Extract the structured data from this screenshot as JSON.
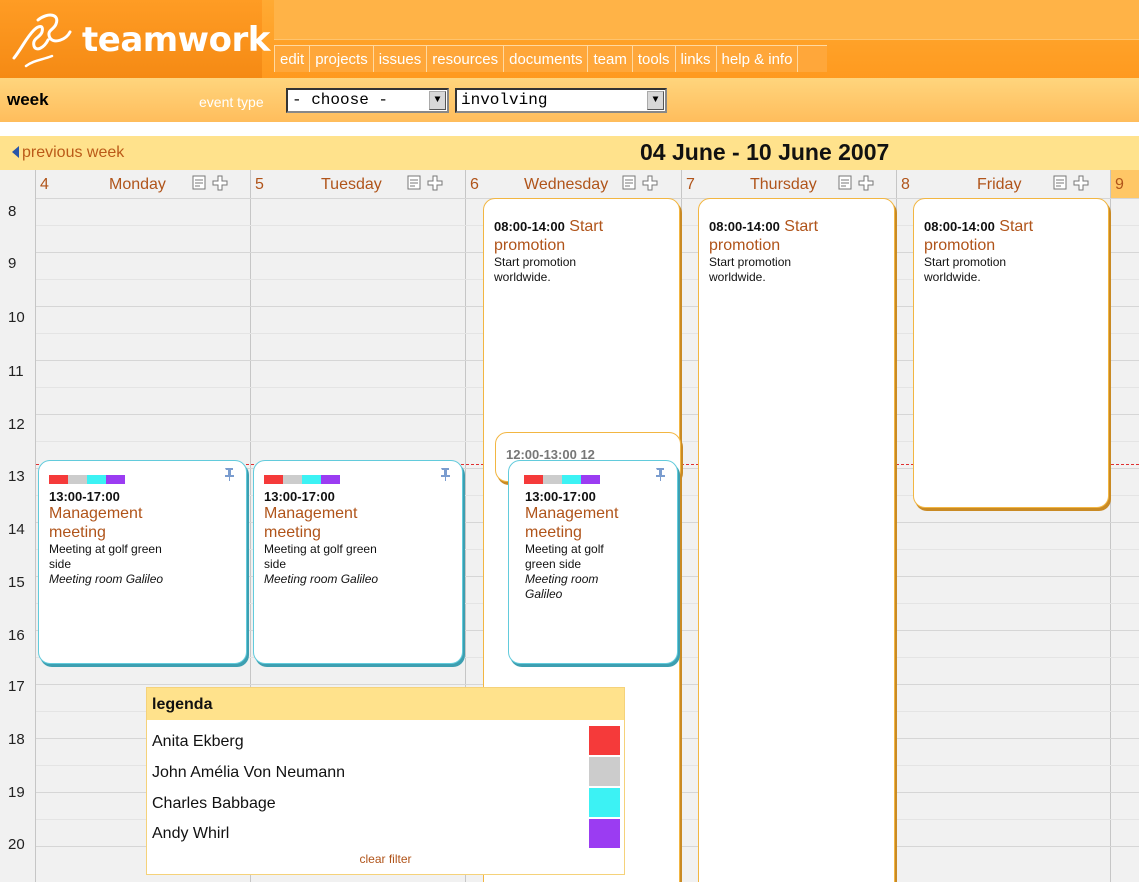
{
  "app": {
    "logo_text": "teamwork"
  },
  "nav": {
    "items": [
      "edit",
      "projects",
      "issues",
      "resources",
      "documents",
      "team",
      "tools",
      "links",
      "help & info"
    ]
  },
  "toolbar": {
    "page_label": "week",
    "event_type_label": "event type",
    "event_type_value": "- choose -",
    "involving_value": "involving"
  },
  "week": {
    "prev_label": "previous week",
    "title": "04 June - 10 June 2007"
  },
  "days": [
    {
      "num": "4",
      "name": "Monday"
    },
    {
      "num": "5",
      "name": "Tuesday"
    },
    {
      "num": "6",
      "name": "Wednesday"
    },
    {
      "num": "7",
      "name": "Thursday"
    },
    {
      "num": "8",
      "name": "Friday"
    },
    {
      "num": "9",
      "name": ""
    }
  ],
  "hours": [
    "8",
    "9",
    "10",
    "11",
    "12",
    "13",
    "14",
    "15",
    "16",
    "17",
    "18",
    "19",
    "20"
  ],
  "events": {
    "promotion": {
      "time": "08:00-14:00",
      "title_part1": "Start",
      "title_part2": "promotion",
      "desc1": "Start promotion",
      "desc2": "worldwide."
    },
    "meeting": {
      "time": "13:00-17:00",
      "title1": "Management",
      "title2": "meeting",
      "desc_a": "Meeting at golf green",
      "desc_b": "side",
      "loc": "Meeting room Galileo",
      "desc_narrow_a": "Meeting at golf",
      "desc_narrow_b": "green side",
      "loc_narrow_a": "Meeting room",
      "loc_narrow_b": "Galileo"
    },
    "overlap_peek": "12:00-13:00 12"
  },
  "legend": {
    "title": "legenda",
    "people": [
      {
        "name": "Anita Ekberg",
        "color": "#f53a3a"
      },
      {
        "name": "John Amélia Von Neumann",
        "color": "#cccccc"
      },
      {
        "name": "Charles Babbage",
        "color": "#3cf2f4"
      },
      {
        "name": "Andy Whirl",
        "color": "#9b3cf2"
      }
    ],
    "clear_filter": "clear filter"
  },
  "colors": {
    "header_orange": "#ff9a1f",
    "accent_brown": "#b0541a",
    "week_bar": "#ffe28c"
  },
  "icons": [
    "teamwork-logo-icon",
    "notes-icon",
    "add-icon",
    "pin-icon",
    "previous-arrow-icon",
    "dropdown-arrow-icon"
  ]
}
